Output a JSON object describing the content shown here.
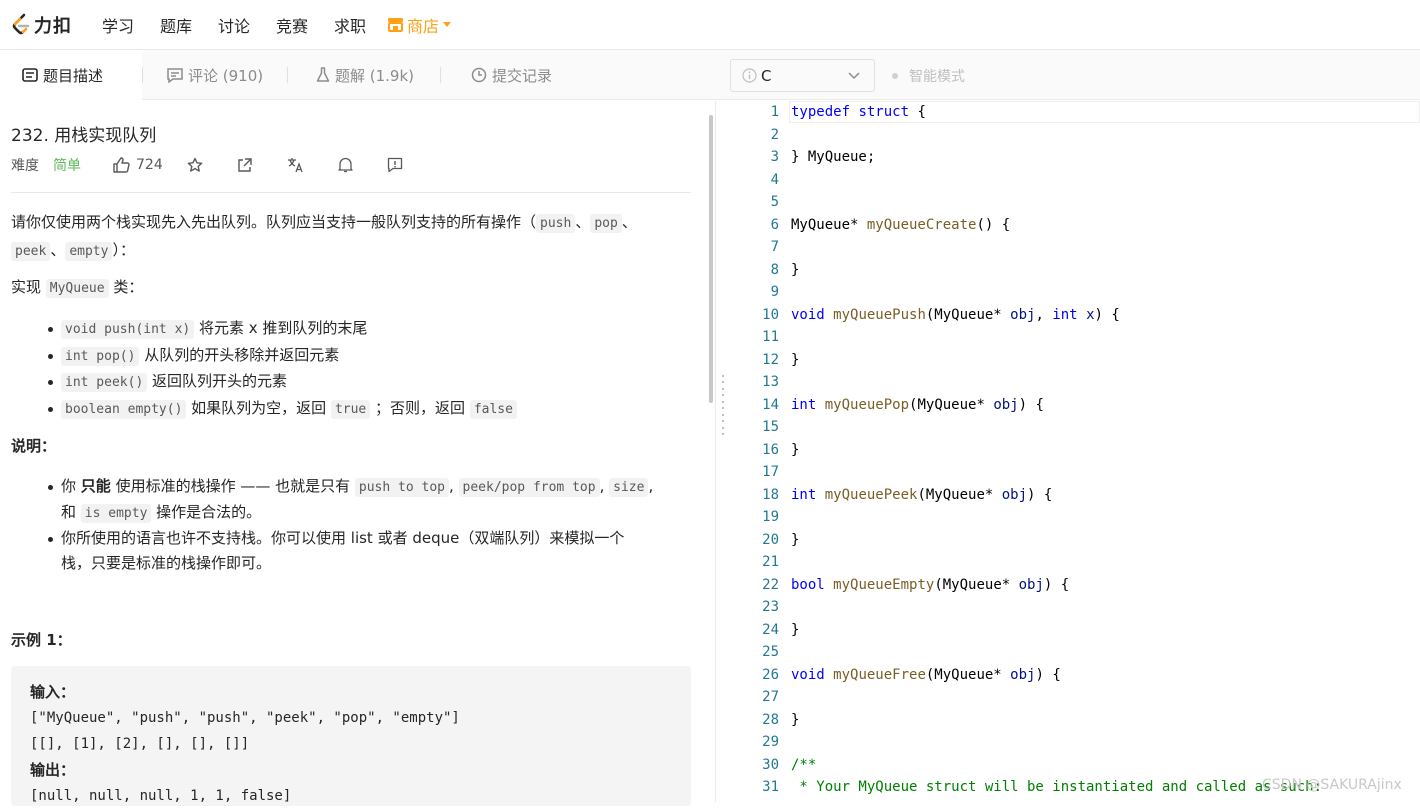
{
  "nav": {
    "logo": "力扣",
    "items": [
      "学习",
      "题库",
      "讨论",
      "竞赛",
      "求职"
    ],
    "store": "商店"
  },
  "tabs": [
    {
      "label": "题目描述"
    },
    {
      "label": "评论 (910)"
    },
    {
      "label": "题解 (1.9k)"
    },
    {
      "label": "提交记录"
    }
  ],
  "editor_bar": {
    "language": "C",
    "smart_mode": "智能模式"
  },
  "problem": {
    "title": "232. 用栈实现队列",
    "difficulty_label": "难度",
    "difficulty": "简单",
    "likes": "724",
    "desc1": "请你仅使用两个栈实现先入先出队列。队列应当支持一般队列支持的所有操作（",
    "c_push": "push",
    "sep": "、",
    "c_pop": "pop",
    "c_peek": "peek",
    "c_empty": "empty",
    "desc1_end": "）：",
    "impl_pre": "实现 ",
    "impl_code": "MyQueue",
    "impl_post": " 类：",
    "methods": [
      {
        "code": "void push(int x)",
        "text": " 将元素 x 推到队列的末尾"
      },
      {
        "code": "int pop()",
        "text": " 从队列的开头移除并返回元素"
      },
      {
        "code": "int peek()",
        "text": " 返回队列开头的元素"
      },
      {
        "code": "boolean empty()",
        "text": " 如果队列为空，返回 ",
        "code2": "true",
        "text2": " ；否则，返回 ",
        "code3": "false"
      }
    ],
    "note_title": "说明：",
    "note1_a": "你 ",
    "note1_bold": "只能",
    "note1_b": " 使用标准的栈操作 —— 也就是只有 ",
    "note1_c1": "push to top",
    "note1_sep": ", ",
    "note1_c2": "peek/pop from top",
    "note1_c3": "size",
    "note1_c": ",",
    "note1_d": "和 ",
    "note1_c4": "is empty",
    "note1_e": " 操作是合法的。",
    "note2_line1": "你所使用的语言也许不支持栈。你可以使用 list 或者 deque（双端队列）来模拟一个",
    "note2_line2": "栈，只要是标准的栈操作即可。",
    "example_title": "示例 1：",
    "ex_input_label": "输入：",
    "ex_input1": "[\"MyQueue\", \"push\", \"push\", \"peek\", \"pop\", \"empty\"]",
    "ex_input2": "[[], [1], [2], [], [], []]",
    "ex_output_label": "输出：",
    "ex_output": "[null, null, null, 1, 1, false]"
  },
  "code_lines": [
    [
      [
        "kw",
        "typedef"
      ],
      [
        "t",
        " "
      ],
      [
        "kw",
        "struct"
      ],
      [
        "t",
        " {"
      ]
    ],
    [],
    [
      [
        "t",
        "} MyQueue;"
      ]
    ],
    [],
    [],
    [
      [
        "t",
        "MyQueue* "
      ],
      [
        "fn",
        "myQueueCreate"
      ],
      [
        "t",
        "() {"
      ]
    ],
    [],
    [
      [
        "t",
        "}"
      ]
    ],
    [],
    [
      [
        "kw",
        "void"
      ],
      [
        "t",
        " "
      ],
      [
        "fn",
        "myQueuePush"
      ],
      [
        "t",
        "(MyQueue* "
      ],
      [
        "va",
        "obj"
      ],
      [
        "t",
        ", "
      ],
      [
        "kw",
        "int"
      ],
      [
        "t",
        " "
      ],
      [
        "va",
        "x"
      ],
      [
        "t",
        ") {"
      ]
    ],
    [],
    [
      [
        "t",
        "}"
      ]
    ],
    [],
    [
      [
        "kw",
        "int"
      ],
      [
        "t",
        " "
      ],
      [
        "fn",
        "myQueuePop"
      ],
      [
        "t",
        "(MyQueue* "
      ],
      [
        "va",
        "obj"
      ],
      [
        "t",
        ") {"
      ]
    ],
    [],
    [
      [
        "t",
        "}"
      ]
    ],
    [],
    [
      [
        "kw",
        "int"
      ],
      [
        "t",
        " "
      ],
      [
        "fn",
        "myQueuePeek"
      ],
      [
        "t",
        "(MyQueue* "
      ],
      [
        "va",
        "obj"
      ],
      [
        "t",
        ") {"
      ]
    ],
    [],
    [
      [
        "t",
        "}"
      ]
    ],
    [],
    [
      [
        "kw",
        "bool"
      ],
      [
        "t",
        " "
      ],
      [
        "fn",
        "myQueueEmpty"
      ],
      [
        "t",
        "(MyQueue* "
      ],
      [
        "va",
        "obj"
      ],
      [
        "t",
        ") {"
      ]
    ],
    [],
    [
      [
        "t",
        "}"
      ]
    ],
    [],
    [
      [
        "kw",
        "void"
      ],
      [
        "t",
        " "
      ],
      [
        "fn",
        "myQueueFree"
      ],
      [
        "t",
        "(MyQueue* "
      ],
      [
        "va",
        "obj"
      ],
      [
        "t",
        ") {"
      ]
    ],
    [],
    [
      [
        "t",
        "}"
      ]
    ],
    [],
    [
      [
        "cm",
        "/**"
      ]
    ],
    [
      [
        "cm",
        " * Your MyQueue struct will be instantiated and called as such:"
      ]
    ]
  ],
  "watermark": "CSDN @SAKURAjinx"
}
